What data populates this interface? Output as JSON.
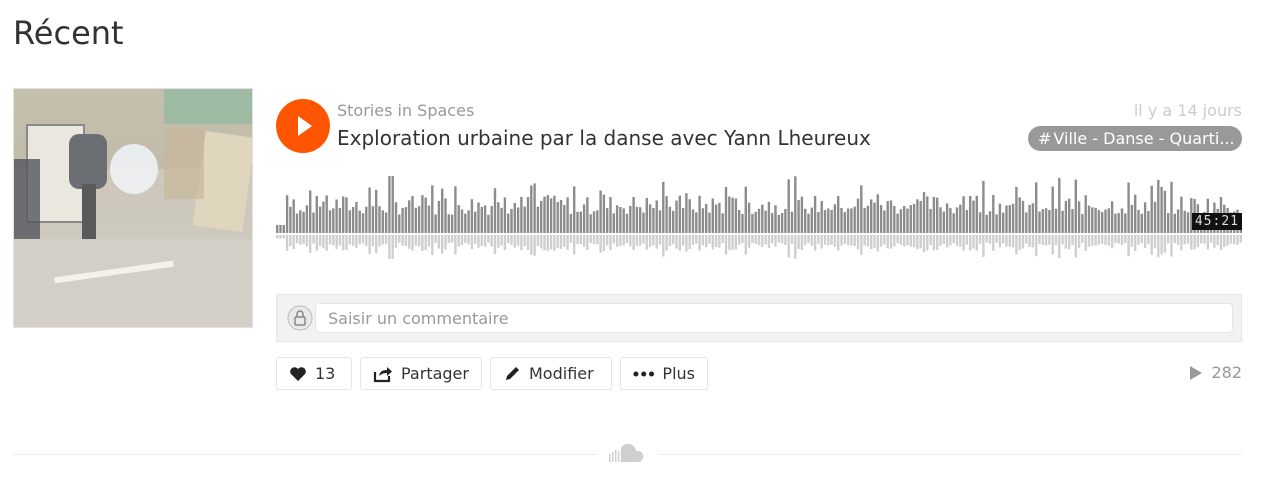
{
  "section": {
    "title": "Récent"
  },
  "track": {
    "uploader": "Stories in Spaces",
    "title": "Exploration urbaine par la danse avec Yann Lheureux",
    "posted": "il y a 14 jours",
    "tag": "Ville - Danse - Quarti...",
    "duration": "45:21",
    "play_count": "282",
    "artwork_icon": "dancer-artwork-image"
  },
  "player": {
    "play_icon": "play-icon",
    "accent_color": "#ff5500"
  },
  "comment": {
    "placeholder": "Saisir un commentaire",
    "value": "",
    "avatar_icon": "user-avatar-icon"
  },
  "actions": {
    "like_count": "13",
    "share_label": "Partager",
    "edit_label": "Modifier",
    "more_label": "Plus"
  },
  "footer": {
    "logo_icon": "soundcloud-cloud-icon"
  }
}
